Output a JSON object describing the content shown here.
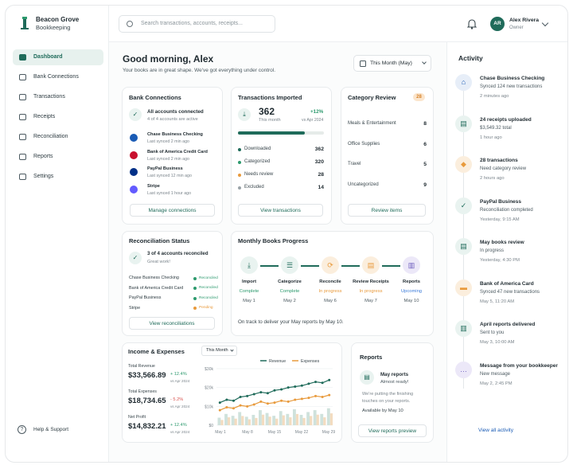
{
  "brand": {
    "name": "Beacon Grove",
    "sub": "Bookkeeping"
  },
  "search": {
    "placeholder": "Search transactions, accounts, receipts..."
  },
  "user": {
    "initials": "AR",
    "name": "Alex Rivera",
    "role": "Owner"
  },
  "nav": [
    {
      "label": "Dashboard",
      "icon": "home-icon",
      "active": true
    },
    {
      "label": "Bank Connections",
      "icon": "bank-icon"
    },
    {
      "label": "Transactions",
      "icon": "list-icon"
    },
    {
      "label": "Receipts",
      "icon": "receipt-icon"
    },
    {
      "label": "Reconciliation",
      "icon": "refresh-icon"
    },
    {
      "label": "Reports",
      "icon": "report-icon"
    },
    {
      "label": "Settings",
      "icon": "gear-icon"
    }
  ],
  "help": {
    "label": "Help & Support"
  },
  "greeting": {
    "title": "Good morning, Alex",
    "subtitle": "Your books are in great shape. We've got everything under control."
  },
  "period": {
    "label": "This Month (May)"
  },
  "bank": {
    "title": "Bank Connections",
    "status": "All accounts connected",
    "status_sub": "4 of 4 accounts are active",
    "accounts": [
      {
        "name": "Chase Business Checking",
        "sync": "Last synced 2 min ago",
        "color": "#1a5bb5"
      },
      {
        "name": "Bank of America Credit Card",
        "sync": "Last synced 2 min ago",
        "color": "#c8102e"
      },
      {
        "name": "PayPal Business",
        "sync": "Last synced 12 min ago",
        "color": "#003087"
      },
      {
        "name": "Stripe",
        "sync": "Last synced 1 hour ago",
        "color": "#635bff"
      }
    ],
    "button": "Manage connections"
  },
  "transactions": {
    "title": "Transactions Imported",
    "count": "362",
    "count_sub": "This month",
    "delta": "+12%",
    "delta_sub": "vs Apr 2024",
    "progress": 0.78,
    "rows": [
      {
        "label": "Downloaded",
        "value": "362",
        "color": "#1f6b5a"
      },
      {
        "label": "Categorized",
        "value": "320",
        "color": "#2d9a6e"
      },
      {
        "label": "Needs review",
        "value": "28",
        "color": "#e89a3c"
      },
      {
        "label": "Excluded",
        "value": "14",
        "color": "#9aa3a8"
      }
    ],
    "button": "View transactions"
  },
  "category": {
    "title": "Category Review",
    "badge": "28",
    "rows": [
      {
        "label": "Meals & Entertainment",
        "value": "8"
      },
      {
        "label": "Office Supplies",
        "value": "6"
      },
      {
        "label": "Travel",
        "value": "5"
      },
      {
        "label": "Uncategorized",
        "value": "9"
      }
    ],
    "button": "Review items"
  },
  "recon": {
    "title": "Reconciliation Status",
    "status": "3 of 4 accounts reconciled",
    "status_sub": "Great work!",
    "rows": [
      {
        "label": "Chase Business Checking",
        "status": "Reconciled",
        "color": "#2d9a6e"
      },
      {
        "label": "Bank of America Credit Card",
        "status": "Reconciled",
        "color": "#2d9a6e"
      },
      {
        "label": "PayPal Business",
        "status": "Reconciled",
        "color": "#2d9a6e"
      },
      {
        "label": "Stripe",
        "status": "Pending",
        "color": "#e89a3c"
      }
    ],
    "button": "View reconciliations"
  },
  "progress": {
    "title": "Monthly Books Progress",
    "steps": [
      {
        "name": "Import",
        "status": "Complete",
        "date": "May 1",
        "color": "#2d9a6e",
        "icon": "download-icon",
        "glyph": "⤓"
      },
      {
        "name": "Categorize",
        "status": "Complete",
        "date": "May 2",
        "color": "#2d9a6e",
        "icon": "list-icon",
        "glyph": "☰"
      },
      {
        "name": "Reconcile",
        "status": "In progress",
        "date": "May 6",
        "color": "#e89a3c",
        "icon": "refresh-icon",
        "glyph": "⟳"
      },
      {
        "name": "Review Receipts",
        "status": "In progress",
        "date": "May 7",
        "color": "#e89a3c",
        "icon": "receipt-icon",
        "glyph": "▤"
      },
      {
        "name": "Reports",
        "status": "Upcoming",
        "date": "May 10",
        "color": "#3b7bd9",
        "icon": "chart-icon",
        "glyph": "▥"
      }
    ],
    "footer": "On track to deliver your May reports by May 10."
  },
  "income": {
    "title": "Income & Expenses",
    "period": "This Month",
    "stats": [
      {
        "label": "Total Revenue",
        "value": "$33,566.89",
        "delta": "+ 12.4%",
        "sub": "vs Apr 2024",
        "up": true
      },
      {
        "label": "Total Expenses",
        "value": "$18,734.65",
        "delta": "- 5.2%",
        "sub": "vs Apr 2024",
        "up": false
      },
      {
        "label": "Net Profit",
        "value": "$14,832.21",
        "delta": "+ 12.4%",
        "sub": "vs Apr 2024",
        "up": true
      }
    ]
  },
  "chart_data": {
    "type": "line",
    "categories": [
      "May 1",
      "May 8",
      "May 15",
      "May 22",
      "May 29"
    ],
    "yticks": [
      "$30k",
      "$20k",
      "$10k",
      "$0"
    ],
    "ylim": [
      0,
      30000
    ],
    "series": [
      {
        "name": "Revenue",
        "color": "#1f6b5a",
        "values": [
          12000,
          13500,
          13000,
          15000,
          15500,
          16500,
          17500,
          17000,
          18500,
          19000,
          20000,
          20500,
          21000,
          22000,
          23000,
          22500,
          24000
        ]
      },
      {
        "name": "Expenses",
        "color": "#e89a3c",
        "values": [
          8000,
          9500,
          9000,
          10500,
          10000,
          11000,
          12500,
          11500,
          12000,
          13000,
          12500,
          13500,
          14000,
          14500,
          15500,
          15000,
          16000
        ]
      }
    ],
    "bars": [
      4000,
      6000,
      5000,
      7000,
      4500,
      5500,
      8000,
      6500,
      5000,
      7500,
      6000,
      8500,
      5500,
      7000,
      8000,
      6000,
      9000
    ],
    "bar_colors": [
      "#cfe2dc",
      "#f3dcc0"
    ],
    "legend": "top"
  },
  "reports": {
    "title": "Reports",
    "item": "May reports",
    "item_sub": "Almost ready!",
    "desc": "We're putting the finishing touches on your reports.",
    "avail": "Available by May 10",
    "button": "View reports preview"
  },
  "activity": {
    "title": "Activity",
    "items": [
      {
        "title": "Chase Business Checking",
        "sub": "Synced 124 new transactions",
        "time": "2 minutes ago",
        "icon": "bank-icon",
        "glyph": "⌂",
        "bg": "#e7eef8",
        "fg": "#1a5bb5"
      },
      {
        "title": "24 receipts uploaded",
        "sub": "$3,549.32 total",
        "time": "1 hour ago",
        "icon": "receipt-icon",
        "glyph": "▤",
        "bg": "#e9f3f0",
        "fg": "#1f6b5a"
      },
      {
        "title": "28 transactions",
        "sub": "Need category review",
        "time": "2 hours ago",
        "icon": "tag-icon",
        "glyph": "◆",
        "bg": "#fbeedd",
        "fg": "#e89a3c"
      },
      {
        "title": "PayPal Business",
        "sub": "Reconciliation completed",
        "time": "Yesterday, 9:15 AM",
        "icon": "check-circle-icon",
        "glyph": "✓",
        "bg": "#e9f3f0",
        "fg": "#1f6b5a"
      },
      {
        "title": "May books review",
        "sub": "In progress",
        "time": "Yesterday, 4:30 PM",
        "icon": "document-icon",
        "glyph": "▤",
        "bg": "#e9f3f0",
        "fg": "#1f6b5a"
      },
      {
        "title": "Bank of America Card",
        "sub": "Synced 47 new transactions",
        "time": "May 5, 11:20 AM",
        "icon": "card-icon",
        "glyph": "▬",
        "bg": "#fbeedd",
        "fg": "#e89a3c"
      },
      {
        "title": "April reports delivered",
        "sub": "Sent to you",
        "time": "May 3, 10:00 AM",
        "icon": "chart-icon",
        "glyph": "▥",
        "bg": "#e9f3f0",
        "fg": "#1f6b5a"
      },
      {
        "title": "Message from your bookkeeper",
        "sub": "New message",
        "time": "May 2, 2:45 PM",
        "icon": "message-icon",
        "glyph": "…",
        "bg": "#ece8f8",
        "fg": "#6b5bbd"
      }
    ],
    "link": "View all activity"
  }
}
